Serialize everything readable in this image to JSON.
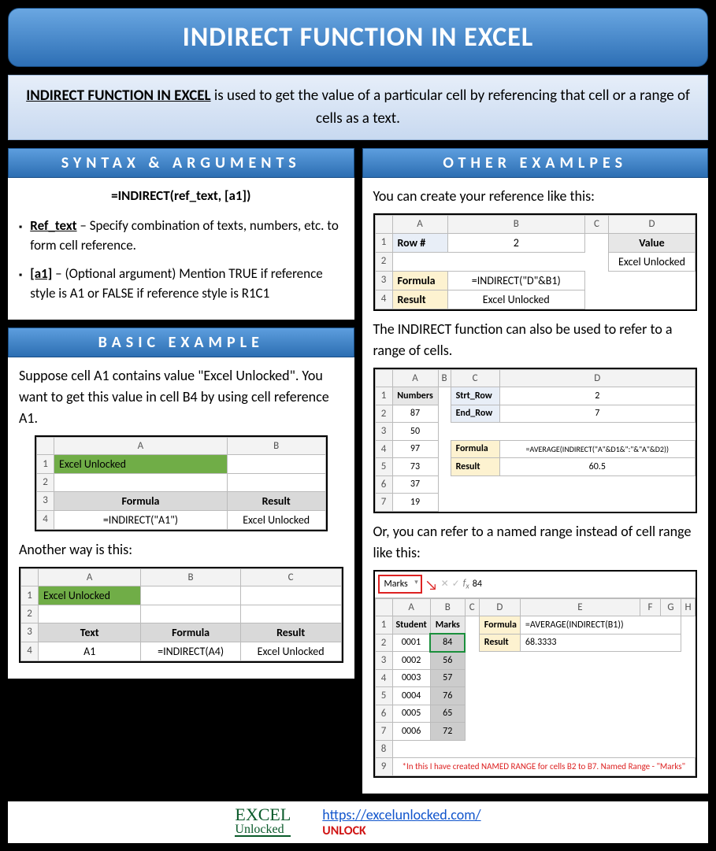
{
  "title": "INDIRECT FUNCTION IN EXCEL",
  "intro": {
    "bold": "INDIRECT FUNCTION IN EXCEL",
    "rest": " is used to get the value of a particular cell by referencing that cell or a range of cells as a text."
  },
  "syntax": {
    "header": "SYNTAX & ARGUMENTS",
    "formula": "=INDIRECT(ref_text, [a1])",
    "args": [
      {
        "name": "Ref_text",
        "desc": " – Specify combination of texts, numbers, etc. to form cell reference."
      },
      {
        "name": "[a1]",
        "desc": " – (Optional argument) Mention TRUE if reference style is A1 or FALSE if reference style is R1C1"
      }
    ]
  },
  "basic": {
    "header": "BASIC EXAMPLE",
    "p1": "Suppose cell A1 contains value \"Excel Unlocked\". You want to get this value in cell B4 by using cell reference A1.",
    "p2": "Another way is this:"
  },
  "other": {
    "header": "OTHER EXAMLPES",
    "p1": "You can create your reference like this:",
    "p2": "The INDIRECT function can also be used to refer to a range of cells.",
    "p3": "Or, you can refer to a named range instead of cell range like this:"
  },
  "ex1": {
    "cols": [
      "",
      "A",
      "B"
    ],
    "r1_a": "Excel Unlocked",
    "r3_a": "Formula",
    "r3_b": "Result",
    "r4_a": "=INDIRECT(\"A1\")",
    "r4_b": "Excel Unlocked"
  },
  "ex2": {
    "cols": [
      "",
      "A",
      "B",
      "C"
    ],
    "r1_a": "Excel Unlocked",
    "r3_a": "Text",
    "r3_b": "Formula",
    "r3_c": "Result",
    "r4_a": "A1",
    "r4_b": "=INDIRECT(A4)",
    "r4_c": "Excel Unlocked"
  },
  "ex3": {
    "cols": [
      "",
      "A",
      "B",
      "C",
      "D"
    ],
    "r1_a": "Row #",
    "r1_b": "2",
    "r1_d": "Value",
    "r2_d": "Excel Unlocked",
    "r3_a": "Formula",
    "r3_b": "=INDIRECT(\"D\"&B1)",
    "r4_a": "Result",
    "r4_b": "Excel Unlocked"
  },
  "ex4": {
    "cols": [
      "",
      "A",
      "B",
      "C",
      "D"
    ],
    "r1_a": "Numbers",
    "r1_c": "Strt_Row",
    "r1_d": "2",
    "r2_a": "87",
    "r2_c": "End_Row",
    "r2_d": "7",
    "r3_a": "50",
    "r4_a": "97",
    "r4_c": "Formula",
    "r4_d": "=AVERAGE(INDIRECT(\"A\"&D1&\":\"&\"A\"&D2))",
    "r5_a": "73",
    "r5_c": "Result",
    "r5_d": "60.5",
    "r6_a": "37",
    "r7_a": "19"
  },
  "ex5": {
    "name_box": "Marks",
    "fx_val": "84",
    "cols": [
      "",
      "A",
      "B",
      "C",
      "D",
      "E",
      "F",
      "G",
      "H"
    ],
    "r1": [
      "Student",
      "Marks",
      "",
      "Formula",
      "=AVERAGE(INDIRECT(B1))"
    ],
    "r2": [
      "0001",
      "84",
      "",
      "Result",
      "68.3333"
    ],
    "r3": [
      "0002",
      "56"
    ],
    "r4": [
      "0003",
      "57"
    ],
    "r5": [
      "0004",
      "76"
    ],
    "r6": [
      "0005",
      "65"
    ],
    "r7": [
      "0006",
      "72"
    ],
    "note": "*In this I have created NAMED RANGE for cells B2 to B7. Named Range - \"Marks\""
  },
  "footer": {
    "logo1": "EXCEL",
    "logo2": "Unlocked",
    "url": "https://excelunlocked.com/",
    "unlock": "UNLOCK"
  }
}
